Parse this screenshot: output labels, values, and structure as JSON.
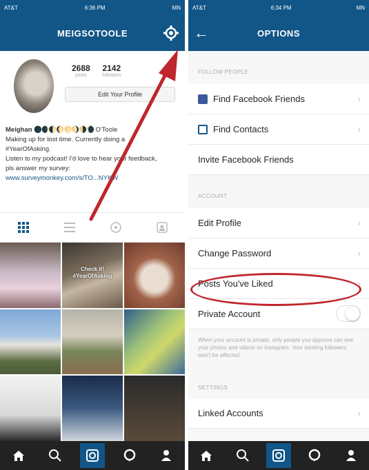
{
  "left": {
    "status": {
      "carrier": "AT&T",
      "time": "6:36 PM",
      "battery": "MN"
    },
    "username": "MEIGSOTOOLE",
    "stats": [
      {
        "num": "2688",
        "label": "posts"
      },
      {
        "num": "2142",
        "label": "followers"
      }
    ],
    "edit_profile": "Edit Your Profile",
    "bio": {
      "name": "Meighan",
      "name_suffix": "O'Toole",
      "moons": "🌑🌒🌓🌔🌕🌖🌗🌘",
      "line1": "Making up for lost time. Currently doing a",
      "line2": "#YearOfAsking.",
      "line3": "Listen to my podcast! I'd love to hear your feedback,",
      "line4": "pls answer my survey:",
      "url": "www.surveymonkey.com/s/TO...NYKW"
    },
    "photo_caption": "Check it! #YearOfAsking"
  },
  "right": {
    "status": {
      "carrier": "AT&T",
      "time": "6:34 PM",
      "battery": "MN"
    },
    "title": "OPTIONS",
    "sections": {
      "follow_people": "FOLLOW PEOPLE",
      "account": "ACCOUNT",
      "settings": "SETTINGS"
    },
    "rows": {
      "find_facebook": "Find Facebook Friends",
      "find_contacts": "Find Contacts",
      "invite_facebook": "Invite Facebook Friends",
      "edit_profile": "Edit Profile",
      "change_password": "Change Password",
      "posts_liked": "Posts You've Liked",
      "private_account": "Private Account",
      "linked_accounts": "Linked Accounts"
    },
    "private_note": "When your account is private, only people you approve can see your photos and videos on Instagram. Your existing followers won't be affected.",
    "chevron": "›"
  },
  "colors": {
    "brand": "#125688",
    "annotation": "#c0262d",
    "tabbar": "#222222"
  },
  "icons": [
    "gear-icon",
    "back-arrow-icon",
    "grid-icon",
    "list-icon",
    "location-icon",
    "tagged-icon",
    "home-icon",
    "search-icon",
    "camera-icon",
    "activity-icon",
    "profile-icon"
  ]
}
